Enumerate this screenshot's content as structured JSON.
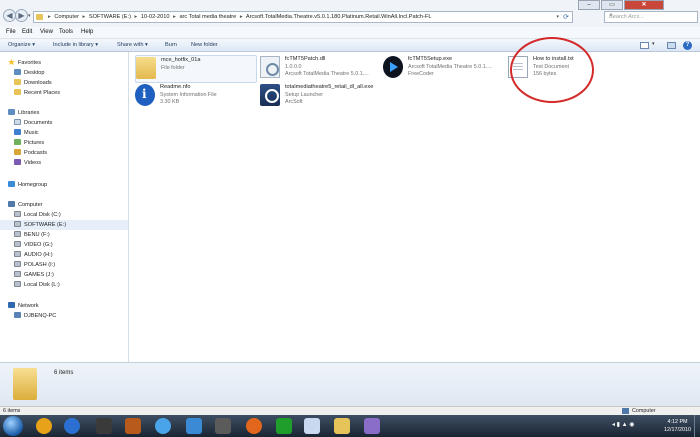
{
  "address": {
    "breadcrumbs": [
      "Computer",
      "SOFTWARE (E:)",
      "10-02-2010",
      "arc Total media theatre",
      "Arcsoft.TotalMedia.Theatre.v5.0.1.180.Platinum.Retail.WinAll.Incl.Patch-FL"
    ],
    "search_placeholder": "Search Arcs...",
    "separator": "▸"
  },
  "window_controls": {
    "minimize": "–",
    "maximize": "▭",
    "close": "✕"
  },
  "menu": [
    "File",
    "Edit",
    "View",
    "Tools",
    "Help"
  ],
  "toolbar": {
    "organize": "Organize ▾",
    "include": "Include in library ▾",
    "share": "Share with ▾",
    "burn": "Burn",
    "new_folder": "New folder"
  },
  "nav": {
    "favorites": {
      "title": "Favorites",
      "items": [
        "Desktop",
        "Downloads",
        "Recent Places"
      ]
    },
    "libraries": {
      "title": "Libraries",
      "items": [
        "Documents",
        "Music",
        "Pictures",
        "Podcasts",
        "Videos"
      ]
    },
    "homegroup": "Homegroup",
    "computer": {
      "title": "Computer",
      "drives": [
        "Local Disk (C:)",
        "SOFTWARE (E:)",
        "BENU (F:)",
        "VIDEO (G:)",
        "AUDIO (H:)",
        "POLASH (I:)",
        "GAMES (J:)",
        "Local Disk (L:)"
      ]
    },
    "network": {
      "title": "Network",
      "items": [
        "DJBENQ-PC"
      ]
    }
  },
  "files": [
    {
      "name": "mce_hotfix_01a",
      "line2": "File folder",
      "line3": "",
      "icon": "folder-icon"
    },
    {
      "name": "fcTMT5Patch.dll",
      "line2": "1.0.0.0",
      "line3": "Arcsoft TotalMedia Theatre 5.0.1....",
      "icon": "dll-icon"
    },
    {
      "name": "fcTMT5Setup.exe",
      "line2": "Arcsoft TotalMedia Theatre 5.0.1....",
      "line3": "FreeCoder",
      "icon": "exe-icon"
    },
    {
      "name": "How to install.txt",
      "line2": "Text Document",
      "line3": "156 bytes",
      "icon": "text-document-icon"
    },
    {
      "name": "Readme.nfo",
      "line2": "System Information File",
      "line3": "3.30 KB",
      "icon": "info-icon"
    },
    {
      "name": "totalmediatheatre5_retail_dl_all.exe",
      "line2": "Setup Launcher",
      "line3": "ArcSoft",
      "icon": "setup-icon"
    }
  ],
  "details": {
    "count": "6 items"
  },
  "status": {
    "left": "6 items",
    "right": "Computer"
  },
  "taskbar": {
    "time": "4:12 PM",
    "date": "12/17/2010"
  },
  "colors": {
    "annotation_circle": "#d42a2a",
    "selection": "#e6eefa"
  }
}
